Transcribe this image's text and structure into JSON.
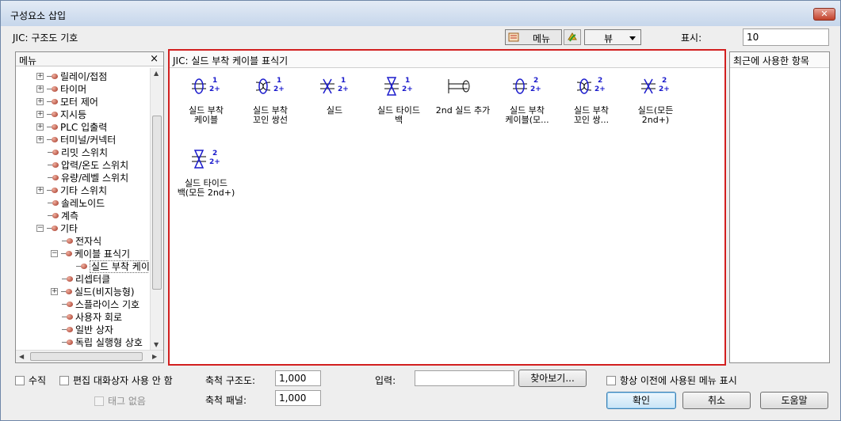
{
  "window": {
    "title": "구성요소 삽입",
    "close_label": "✕"
  },
  "header": {
    "library_label": "JIC: 구조도 기호",
    "display_label": "표시:",
    "display_value": "10"
  },
  "toolbar": {
    "menu_label": "메뉴",
    "view_label": "뷰"
  },
  "menu_panel": {
    "title": "메뉴",
    "close": "×",
    "items": [
      {
        "label": "릴레이/접점",
        "level": 0,
        "exp": "+"
      },
      {
        "label": "타이머",
        "level": 0,
        "exp": "+"
      },
      {
        "label": "모터 제어",
        "level": 0,
        "exp": "+"
      },
      {
        "label": "지시등",
        "level": 0,
        "exp": "+"
      },
      {
        "label": "PLC 입출력",
        "level": 0,
        "exp": "+"
      },
      {
        "label": "터미널/커넥터",
        "level": 0,
        "exp": "+"
      },
      {
        "label": "리밋 스위치",
        "level": 0,
        "exp": ""
      },
      {
        "label": "압력/온도 스위치",
        "level": 0,
        "exp": ""
      },
      {
        "label": "유량/레벨 스위치",
        "level": 0,
        "exp": ""
      },
      {
        "label": "기타 스위치",
        "level": 0,
        "exp": "+"
      },
      {
        "label": "솔레노이드",
        "level": 0,
        "exp": ""
      },
      {
        "label": "계측",
        "level": 0,
        "exp": ""
      },
      {
        "label": "기타",
        "level": 0,
        "exp": "−"
      },
      {
        "label": "전자식",
        "level": 1,
        "exp": ""
      },
      {
        "label": "케이블 표식기",
        "level": 1,
        "exp": "−"
      },
      {
        "label": "실드 부착 케이",
        "level": 2,
        "exp": "",
        "selected": true
      },
      {
        "label": "리셉터클",
        "level": 1,
        "exp": ""
      },
      {
        "label": "실드(비지능형)",
        "level": 1,
        "exp": "+"
      },
      {
        "label": "스플라이스 기호",
        "level": 1,
        "exp": ""
      },
      {
        "label": "사용자 회로",
        "level": 1,
        "exp": ""
      },
      {
        "label": "일반 상자",
        "level": 1,
        "exp": ""
      },
      {
        "label": "독립 실행형 상호",
        "level": 1,
        "exp": ""
      }
    ]
  },
  "center_panel": {
    "title": "JIC: 실드 부착 케이블 표식기",
    "items": [
      {
        "cap1": "실드 부착",
        "cap2": "케이블",
        "glyph": "shield",
        "n1": "1",
        "n2": "2+"
      },
      {
        "cap1": "실드 부착",
        "cap2": "꼬인 쌍선",
        "glyph": "twisted",
        "n1": "1",
        "n2": "2+"
      },
      {
        "cap1": "실드",
        "cap2": "",
        "glyph": "xshield",
        "n1": "1",
        "n2": "2+"
      },
      {
        "cap1": "실드 타이드",
        "cap2": "백",
        "glyph": "tieback",
        "n1": "1",
        "n2": "2+"
      },
      {
        "cap1": "2nd 실드 추가",
        "cap2": "",
        "glyph": "second",
        "n1": "",
        "n2": ""
      },
      {
        "cap1": "실드 부착",
        "cap2": "케이블(모...",
        "glyph": "shield",
        "n1": "2",
        "n2": "2+"
      },
      {
        "cap1": "실드 부착",
        "cap2": "꼬인 쌍...",
        "glyph": "twisted",
        "n1": "2",
        "n2": "2+"
      },
      {
        "cap1": "실드(모든",
        "cap2": "2nd+)",
        "glyph": "xshield",
        "n1": "2",
        "n2": "2+"
      },
      {
        "cap1": "실드 타이드",
        "cap2": "백(모든 2nd+)",
        "glyph": "tieback",
        "n1": "2",
        "n2": "2+"
      }
    ]
  },
  "recent_panel": {
    "title": "최근에 사용한 항목"
  },
  "bottom": {
    "vertical_label": "수직",
    "no_edit_dialog_label": "편집 대화상자 사용 안 함",
    "no_tag_label": "태그 없음",
    "scale_schematic_label": "축척 구조도:",
    "scale_schematic_value": "1,000",
    "scale_panel_label": "축척 패널:",
    "scale_panel_value": "1,000",
    "input_label": "입력:",
    "input_value": "",
    "browse_label": "찾아보기...",
    "always_show_label": "항상 이전에 사용된 메뉴 표시",
    "ok_label": "확인",
    "cancel_label": "취소",
    "help_label": "도움말"
  },
  "colors": {
    "highlight_border": "#d21f1f",
    "symbol_blue": "#1a1acc"
  }
}
